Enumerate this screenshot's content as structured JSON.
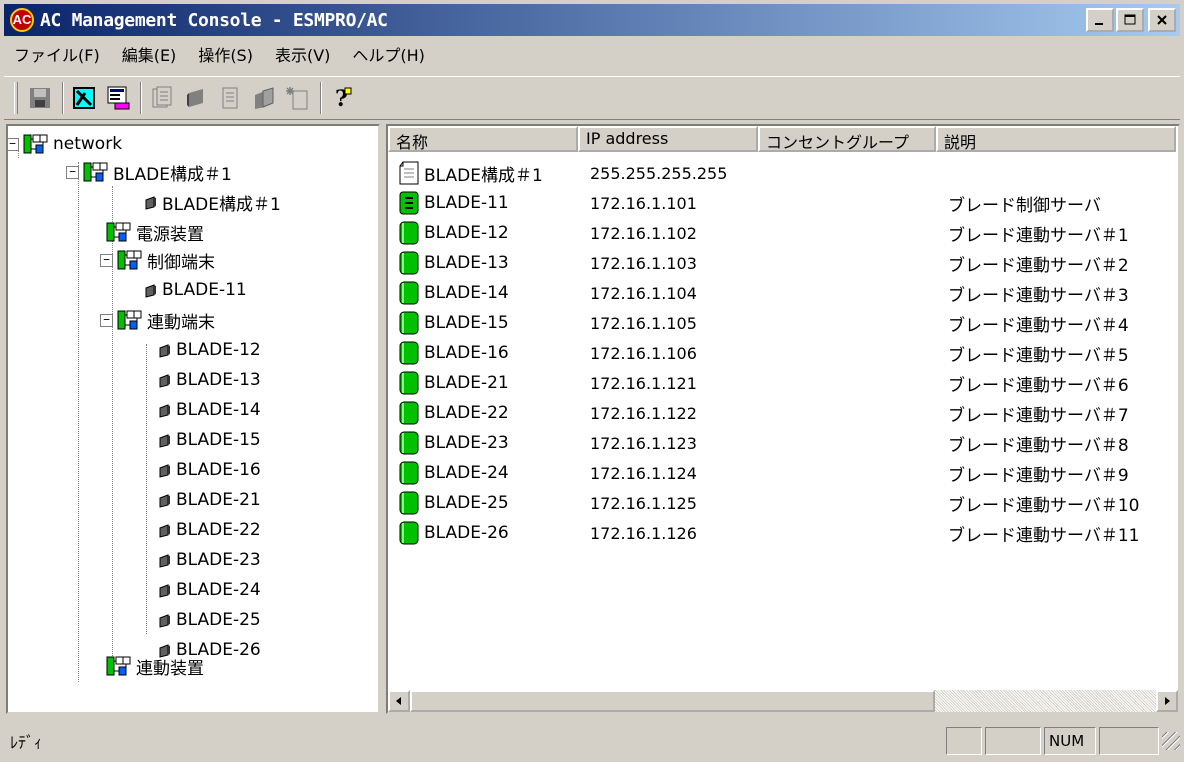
{
  "window": {
    "title": "AC Management Console - ESMPRO/AC",
    "app_icon_text": "AC"
  },
  "menu": [
    "ファイル(F)",
    "編集(E)",
    "操作(S)",
    "表示(V)",
    "ヘルプ(H)"
  ],
  "toolbar": {
    "icons": [
      "save-icon",
      "network-map-icon",
      "properties-icon",
      "copy-page-icon",
      "power-icon",
      "page-icon",
      "pages-icon",
      "new-page-icon",
      "help-icon"
    ]
  },
  "tree": {
    "root": "network",
    "group": "BLADE構成＃1",
    "group_child": "BLADE構成＃1",
    "power": "電源装置",
    "control": "制御端末",
    "control_child": "BLADE-11",
    "linked": "連動端末",
    "linked_children": [
      "BLADE-12",
      "BLADE-13",
      "BLADE-14",
      "BLADE-15",
      "BLADE-16",
      "BLADE-21",
      "BLADE-22",
      "BLADE-23",
      "BLADE-24",
      "BLADE-25",
      "BLADE-26"
    ],
    "linked_device": "連動装置"
  },
  "list": {
    "columns": [
      "名称",
      "IP address",
      "コンセントグループ",
      "説明"
    ],
    "rows": [
      {
        "name": "BLADE構成＃1",
        "ip": "255.255.255.255",
        "group": "",
        "desc": "",
        "icon": "document-icon"
      },
      {
        "name": "BLADE-11",
        "ip": "172.16.1.101",
        "group": "",
        "desc": "ブレード制御サーバ",
        "icon": "control-server-icon"
      },
      {
        "name": "BLADE-12",
        "ip": "172.16.1.102",
        "group": "",
        "desc": "ブレード連動サーバ＃1",
        "icon": "server-icon"
      },
      {
        "name": "BLADE-13",
        "ip": "172.16.1.103",
        "group": "",
        "desc": "ブレード連動サーバ＃2",
        "icon": "server-icon"
      },
      {
        "name": "BLADE-14",
        "ip": "172.16.1.104",
        "group": "",
        "desc": "ブレード連動サーバ＃3",
        "icon": "server-icon"
      },
      {
        "name": "BLADE-15",
        "ip": "172.16.1.105",
        "group": "",
        "desc": "ブレード連動サーバ＃4",
        "icon": "server-icon"
      },
      {
        "name": "BLADE-16",
        "ip": "172.16.1.106",
        "group": "",
        "desc": "ブレード連動サーバ＃5",
        "icon": "server-icon"
      },
      {
        "name": "BLADE-21",
        "ip": "172.16.1.121",
        "group": "",
        "desc": "ブレード連動サーバ＃6",
        "icon": "server-icon"
      },
      {
        "name": "BLADE-22",
        "ip": "172.16.1.122",
        "group": "",
        "desc": "ブレード連動サーバ＃7",
        "icon": "server-icon"
      },
      {
        "name": "BLADE-23",
        "ip": "172.16.1.123",
        "group": "",
        "desc": "ブレード連動サーバ＃8",
        "icon": "server-icon"
      },
      {
        "name": "BLADE-24",
        "ip": "172.16.1.124",
        "group": "",
        "desc": "ブレード連動サーバ＃9",
        "icon": "server-icon"
      },
      {
        "name": "BLADE-25",
        "ip": "172.16.1.125",
        "group": "",
        "desc": "ブレード連動サーバ＃10",
        "icon": "server-icon"
      },
      {
        "name": "BLADE-26",
        "ip": "172.16.1.126",
        "group": "",
        "desc": "ブレード連動サーバ＃11",
        "icon": "server-icon"
      }
    ]
  },
  "status": {
    "text": "ﾚﾃﾞｨ",
    "num": "NUM"
  },
  "colors": {
    "title_start": "#0a246a",
    "title_end": "#a6caf0",
    "server_green": "#00c000",
    "chrome": "#d4d0c8"
  }
}
